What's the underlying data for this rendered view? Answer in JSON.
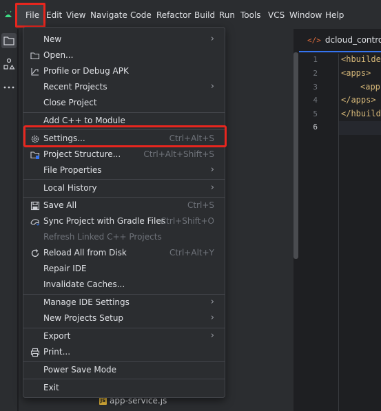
{
  "menubar": {
    "items": [
      {
        "label": "File"
      },
      {
        "label": "Edit"
      },
      {
        "label": "View"
      },
      {
        "label": "Navigate"
      },
      {
        "label": "Code"
      },
      {
        "label": "Refactor"
      },
      {
        "label": "Build"
      },
      {
        "label": "Run"
      },
      {
        "label": "Tools"
      },
      {
        "label": "VCS"
      },
      {
        "label": "Window"
      },
      {
        "label": "Help"
      }
    ]
  },
  "editor": {
    "tab_label": "dcloud_control.xm",
    "line_numbers": [
      "1",
      "2",
      "3",
      "4",
      "5",
      "6"
    ],
    "code_lines": [
      "<hbuilde",
      "<apps>",
      "<app",
      "</apps>",
      "</hbuilde",
      ""
    ]
  },
  "project": {
    "visible_file": "app-service.js",
    "js_badge": "JS"
  },
  "file_menu": {
    "new": "New",
    "open": "Open...",
    "profile_debug": "Profile or Debug APK",
    "recent_projects": "Recent Projects",
    "close_project": "Close Project",
    "add_cpp": "Add C++ to Module",
    "settings": "Settings...",
    "settings_shortcut": "Ctrl+Alt+S",
    "project_structure": "Project Structure...",
    "project_structure_shortcut": "Ctrl+Alt+Shift+S",
    "file_properties": "File Properties",
    "local_history": "Local History",
    "save_all": "Save All",
    "save_all_shortcut": "Ctrl+S",
    "sync_gradle": "Sync Project with Gradle Files",
    "sync_gradle_shortcut": "Ctrl+Shift+O",
    "refresh_cpp": "Refresh Linked C++ Projects",
    "reload_disk": "Reload All from Disk",
    "reload_disk_shortcut": "Ctrl+Alt+Y",
    "repair_ide": "Repair IDE",
    "invalidate_caches": "Invalidate Caches...",
    "manage_ide_settings": "Manage IDE Settings",
    "new_projects_setup": "New Projects Setup",
    "export": "Export",
    "print": "Print...",
    "power_save": "Power Save Mode",
    "exit": "Exit"
  },
  "colors": {
    "highlight_box": "#e8261e",
    "accent": "#3574f0",
    "menu_bg": "#2b2d30"
  }
}
